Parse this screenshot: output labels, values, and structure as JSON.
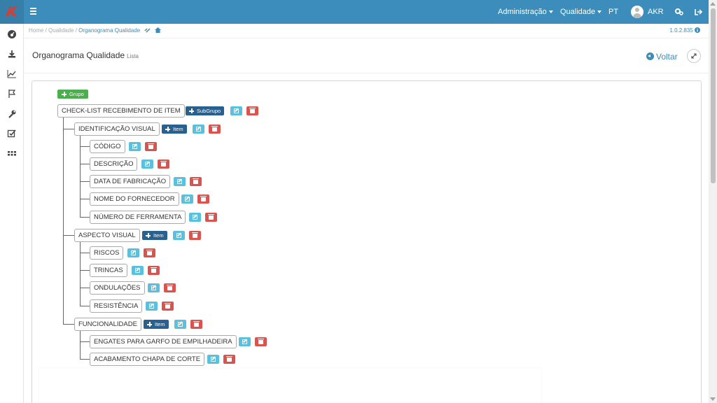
{
  "header": {
    "menu_administracao": "Administração",
    "menu_qualidade": "Qualidade",
    "lang": "PT",
    "user": "AKR"
  },
  "sidebar": {
    "icons": [
      "dashboard-icon",
      "download-icon",
      "line-chart-icon",
      "flag-icon",
      "wrench-icon",
      "checkbox-icon",
      "grid-icon"
    ]
  },
  "breadcrumb": {
    "home": "Home",
    "sep1": " / ",
    "qualidade": "Qualidade",
    "sep2": " / ",
    "current": "Organograma Qualidade"
  },
  "version": "1.0.2.835",
  "page": {
    "title": "Organograma Qualidade",
    "subtitle": "Lista",
    "back": "Voltar"
  },
  "tree": {
    "group_button": "Grupo",
    "subgroup_button": "SubGrupo",
    "item_button": "Item",
    "root": "CHECK-LIST RECEBIMENTO DE ITEM",
    "subgroups": [
      {
        "label": "IDENTIFICAÇÃO VISUAL",
        "items": [
          "CÓDIGO",
          "DESCRIÇÃO",
          "DATA DE FABRICAÇÃO",
          "NOME DO FORNECEDOR",
          "NÚMERO DE FERRAMENTA"
        ]
      },
      {
        "label": "ASPECTO VISUAL",
        "items": [
          "RISCOS",
          "TRINCAS",
          "ONDULAÇÕES",
          "RESISTÊNCIA"
        ]
      },
      {
        "label": "FUNCIONALIDADE",
        "items": [
          "ENGATES PARA GARFO DE EMPILHADEIRA",
          "ACABAMENTO CHAPA DE CORTE"
        ]
      }
    ]
  },
  "colors": {
    "header": "#3c8dbc",
    "primary_button": "#286090",
    "success_button": "#4cae4c",
    "edit_button": "#5bc0de",
    "delete_button": "#d9534f"
  }
}
